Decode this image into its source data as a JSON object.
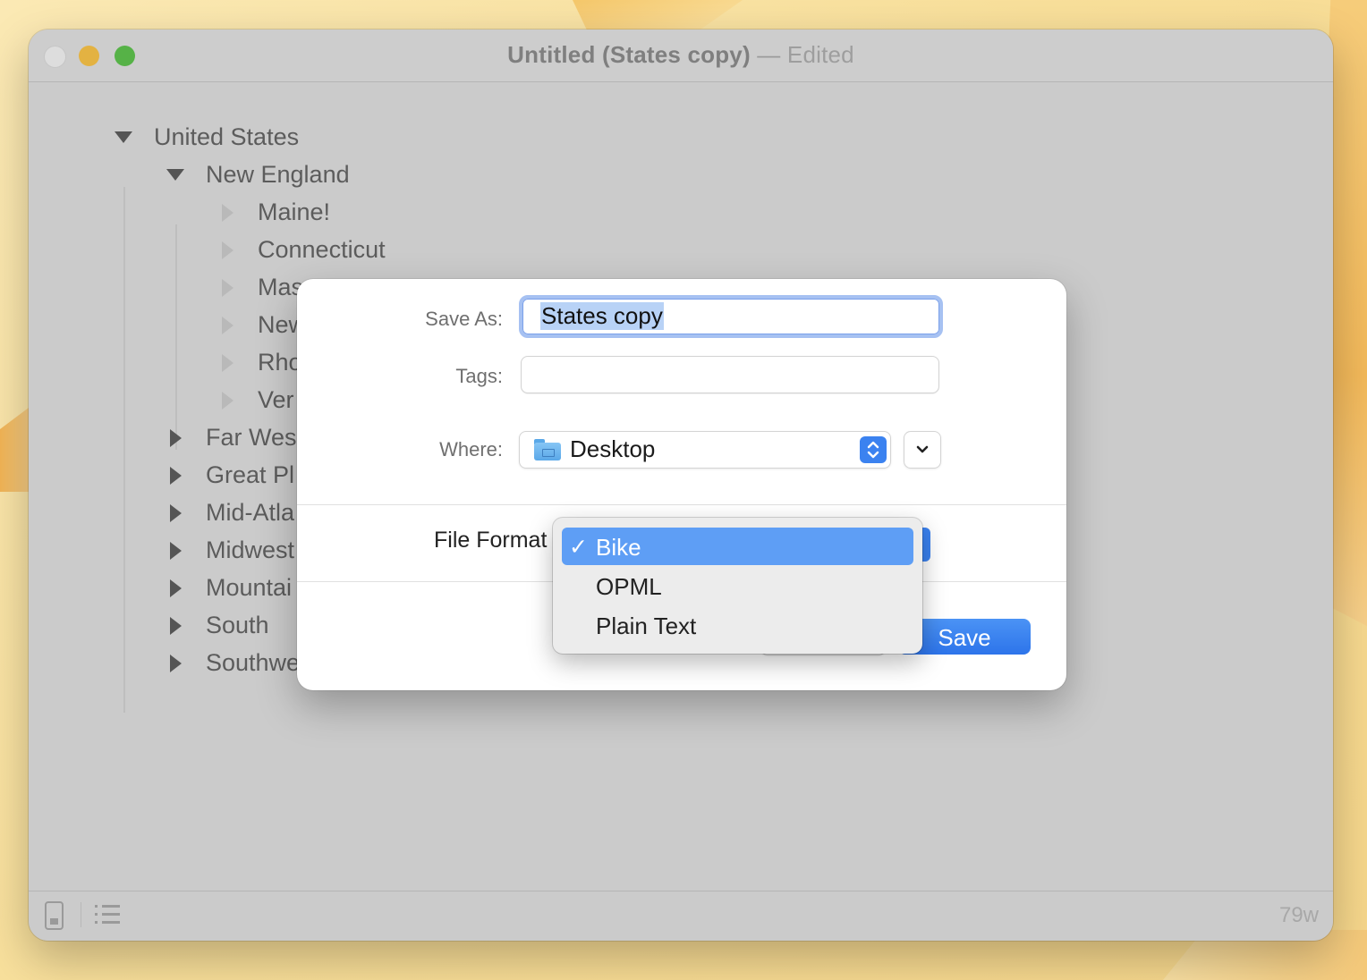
{
  "window": {
    "title": "Untitled (States copy)",
    "title_separator": "—",
    "edited_label": "Edited"
  },
  "outline": {
    "rows": [
      {
        "label": "United States",
        "state": "expanded"
      },
      {
        "label": "New England",
        "state": "expanded"
      },
      {
        "label": "Maine!",
        "state": "leaf"
      },
      {
        "label": "Connecticut",
        "state": "leaf"
      },
      {
        "label": "Mas",
        "state": "leaf"
      },
      {
        "label": "New",
        "state": "leaf"
      },
      {
        "label": "Rho",
        "state": "leaf"
      },
      {
        "label": "Ver",
        "state": "leaf"
      },
      {
        "label": "Far Wes",
        "state": "collapsed"
      },
      {
        "label": "Great Pl",
        "state": "collapsed"
      },
      {
        "label": "Mid-Atla",
        "state": "collapsed"
      },
      {
        "label": "Midwest",
        "state": "collapsed"
      },
      {
        "label": "Mountai",
        "state": "collapsed"
      },
      {
        "label": "South",
        "state": "collapsed"
      },
      {
        "label": "Southwe",
        "state": "collapsed"
      }
    ]
  },
  "save_dialog": {
    "save_as_label": "Save As:",
    "save_as_value": "States copy",
    "tags_label": "Tags:",
    "tags_value": "",
    "where_label": "Where:",
    "where_value": "Desktop",
    "file_format_label": "File Format",
    "save_button": "Save"
  },
  "format_menu": {
    "items": [
      {
        "label": "Bike",
        "checked": true,
        "check_mark": "✓"
      },
      {
        "label": "OPML",
        "checked": false
      },
      {
        "label": "Plain Text",
        "checked": false
      }
    ]
  },
  "statusbar": {
    "word_count": "79w"
  },
  "colors": {
    "accent": "#3b82f0",
    "menu_highlight": "#5e9ef5",
    "window_bg": "#cbcbcb",
    "light_close": "#dddddd",
    "light_minimize": "#e3b242",
    "light_maximize": "#56b247"
  },
  "icons": {
    "statusbar_left": "phone-preview-icon",
    "statusbar_right": "list-icon",
    "where": "folder-icon",
    "where_stepper": "up-down-chevron-icon",
    "expand": "chevron-down-icon"
  }
}
